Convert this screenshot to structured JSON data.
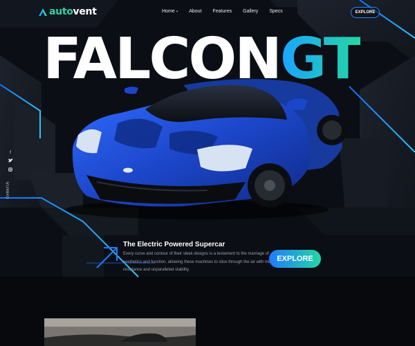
{
  "brand": {
    "logo_prefix": "auto",
    "logo_suffix": "vent"
  },
  "nav": {
    "items": [
      {
        "label": "Home"
      },
      {
        "label": "About"
      },
      {
        "label": "Features"
      },
      {
        "label": "Gallery"
      },
      {
        "label": "Specs"
      }
    ],
    "cta_label": "EXPLORE"
  },
  "hero": {
    "title_part1": "FALCON",
    "title_part2": "GT",
    "subtitle": "The Electric Powered Supercar",
    "description": "Every curve and contour of their sleek designs is a testament to the marriage of aesthetics and function, allowing these machines to slice through the air with minimal resistance and unparalleled stability.",
    "cta_label": "EXPLORE"
  },
  "sidebar": {
    "social_icons": [
      "facebook-icon",
      "twitter-icon",
      "instagram-icon"
    ],
    "contact_label": "Contact Us"
  },
  "colors": {
    "background": "#0b0e14",
    "accent_blue": "#1aa4ff",
    "accent_green": "#25d6a4",
    "car_blue": "#1f4fd1"
  }
}
